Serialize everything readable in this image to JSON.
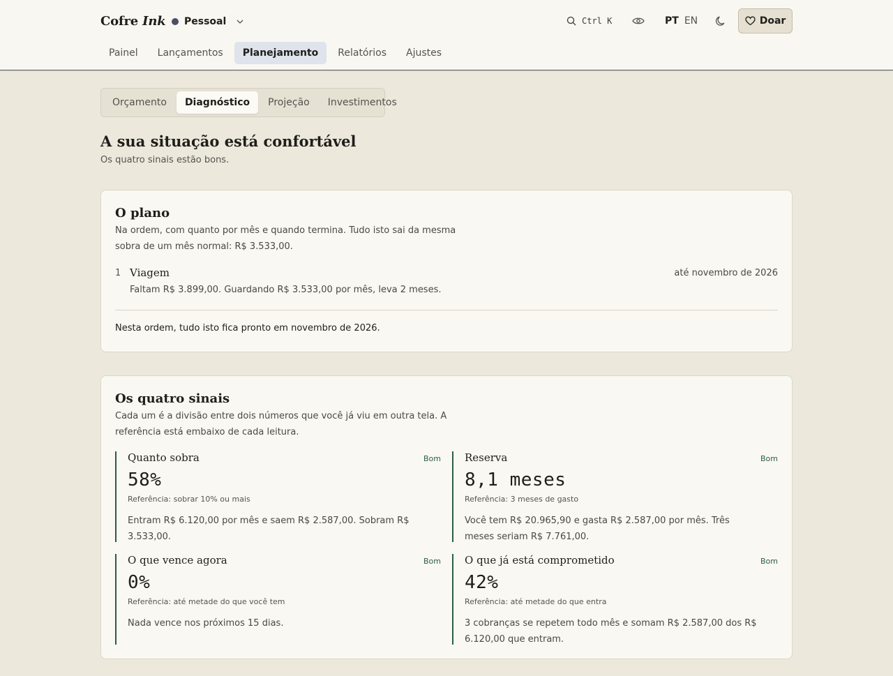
{
  "header": {
    "brand_main": "Cofre",
    "brand_accent": "Ink",
    "profile": {
      "label": "Pessoal",
      "color": "#495068"
    },
    "search": {
      "shortcut": "Ctrl K",
      "icon": "search-icon"
    },
    "privacy_icon": "eye-icon",
    "languages": {
      "active": "PT",
      "other": "EN"
    },
    "theme_icon": "moon-icon",
    "donate": {
      "label": "Doar",
      "icon": "heart-icon"
    }
  },
  "nav": {
    "tabs": [
      {
        "label": "Painel"
      },
      {
        "label": "Lançamentos"
      },
      {
        "label": "Planejamento"
      },
      {
        "label": "Relatórios"
      },
      {
        "label": "Ajustes"
      }
    ],
    "active": "Planejamento"
  },
  "subnav": {
    "tabs": [
      {
        "label": "Orçamento"
      },
      {
        "label": "Diagnóstico"
      },
      {
        "label": "Projeção"
      },
      {
        "label": "Investimentos"
      }
    ],
    "active": "Diagnóstico"
  },
  "main": {
    "title": "A sua situação está confortável",
    "subtitle": "Os quatro sinais estão bons."
  },
  "plan": {
    "title": "O plano",
    "description": "Na ordem, com quanto por mês e quando termina. Tudo isto sai da mesma sobra de um mês normal: R$ 3.533,00.",
    "goals": [
      {
        "number": "1",
        "name": "Viagem",
        "when": "até novembro de 2026",
        "detail": "Faltam R$ 3.899,00. Guardando R$ 3.533,00 por mês, leva 2 meses."
      }
    ],
    "summary": "Nesta ordem, tudo isto fica pronto em novembro de 2026."
  },
  "signals": {
    "title": "Os quatro sinais",
    "description": "Cada um é a divisão entre dois números que você já viu em outra tela. A referência está embaixo de cada leitura.",
    "accent_color": "#2d5c46",
    "items": [
      {
        "name": "Quanto sobra",
        "status": "Bom",
        "value": "58%",
        "reference": "Referência: sobrar 10% ou mais",
        "text": "Entram R$ 6.120,00 por mês e saem R$ 2.587,00. Sobram R$ 3.533,00."
      },
      {
        "name": "Reserva",
        "status": "Bom",
        "value": "8,1 meses",
        "reference": "Referência: 3 meses de gasto",
        "text": "Você tem R$ 20.965,90 e gasta R$ 2.587,00 por mês. Três meses seriam R$ 7.761,00."
      },
      {
        "name": "O que vence agora",
        "status": "Bom",
        "value": "0%",
        "reference": "Referência: até metade do que você tem",
        "text": "Nada vence nos próximos 15 dias."
      },
      {
        "name": "O que já está comprometido",
        "status": "Bom",
        "value": "42%",
        "reference": "Referência: até metade do que entra",
        "text": "3 cobranças se repetem todo mês e somam R$ 2.587,00 dos R$ 6.120,00 que entram."
      }
    ]
  }
}
